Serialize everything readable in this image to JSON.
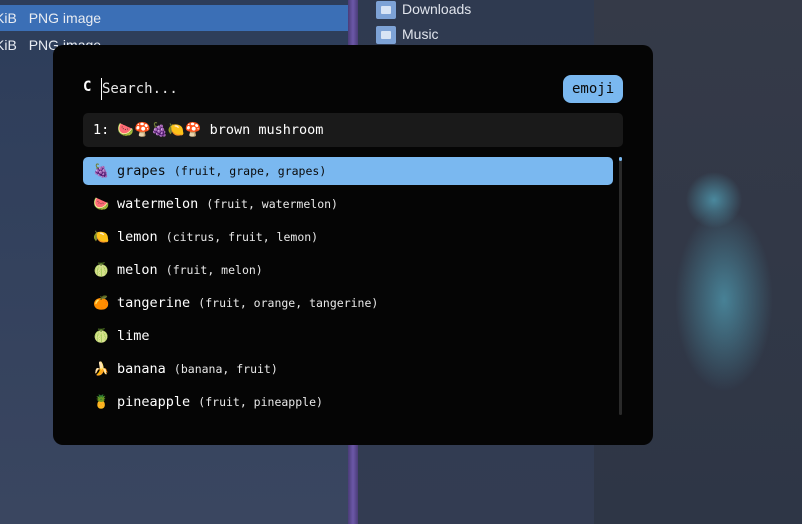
{
  "background": {
    "files": [
      {
        "size": "KiB",
        "type": "PNG image",
        "selected": true
      },
      {
        "size": "KiB",
        "type": "PNG image",
        "selected": false
      }
    ],
    "places": [
      "Downloads",
      "Music"
    ]
  },
  "launcher": {
    "prompt": "C",
    "search": {
      "value": "",
      "placeholder": "Search..."
    },
    "mode_label": "emoji",
    "preview": {
      "index": "1:",
      "emojis": "🍉🍄🍇🍋🍄",
      "name": "brown mushroom"
    },
    "results": [
      {
        "emoji": "🍇",
        "name": "grapes",
        "keywords": "(fruit, grape, grapes)"
      },
      {
        "emoji": "🍉",
        "name": "watermelon",
        "keywords": "(fruit, watermelon)"
      },
      {
        "emoji": "🍋",
        "name": "lemon",
        "keywords": "(citrus, fruit, lemon)"
      },
      {
        "emoji": "🍈",
        "name": "melon",
        "keywords": "(fruit, melon)"
      },
      {
        "emoji": "🍊",
        "name": "tangerine",
        "keywords": "(fruit, orange, tangerine)"
      },
      {
        "emoji": "🍈",
        "name": "lime",
        "keywords": ""
      },
      {
        "emoji": "🍌",
        "name": "banana",
        "keywords": "(banana, fruit)"
      },
      {
        "emoji": "🍍",
        "name": "pineapple",
        "keywords": "(fruit, pineapple)"
      }
    ]
  },
  "colors": {
    "accent": "#7ab8f0",
    "launcher_bg": "#050505",
    "preview_bg": "#1a1a1a"
  }
}
